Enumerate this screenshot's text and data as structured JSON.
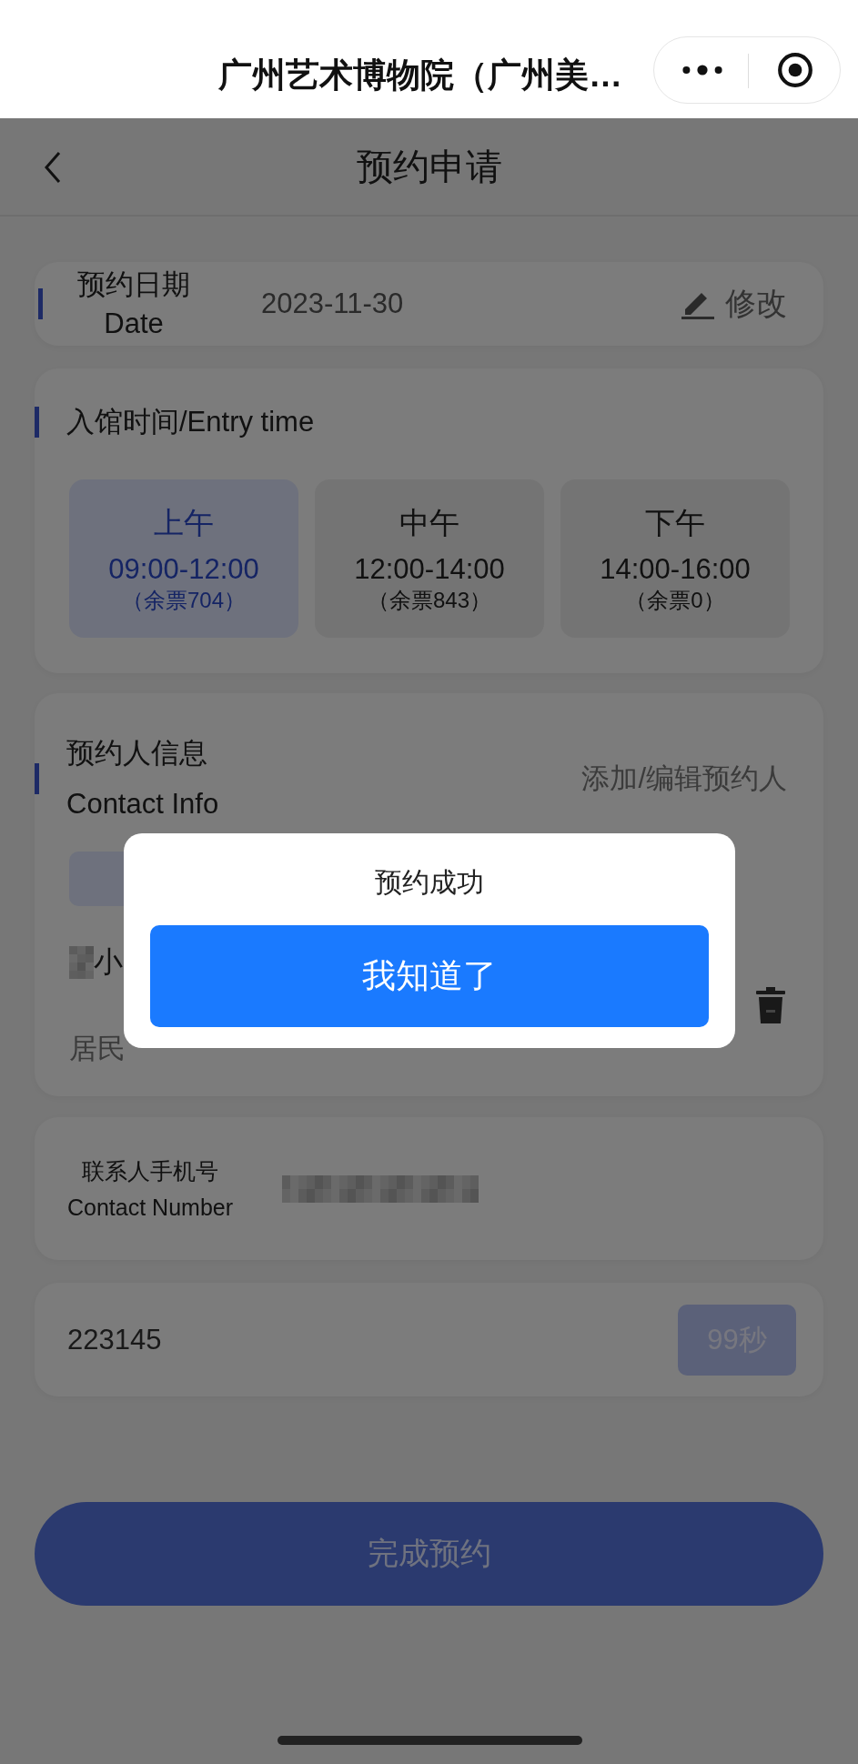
{
  "miniapp_bar": {
    "title": "广州艺术博物院（广州美…"
  },
  "nav": {
    "title": "预约申请"
  },
  "date": {
    "label_cn": "预约日期",
    "label_en": "Date",
    "value": "2023-11-30",
    "edit": "修改"
  },
  "entry_time": {
    "title": "入馆时间/Entry time",
    "slots": [
      {
        "period": "上午",
        "time": "09:00-12:00",
        "remaining": "（余票704）",
        "selected": true
      },
      {
        "period": "中午",
        "time": "12:00-14:00",
        "remaining": "（余票843）",
        "selected": false
      },
      {
        "period": "下午",
        "time": "14:00-16:00",
        "remaining": "（余票0）",
        "selected": false
      }
    ]
  },
  "contact": {
    "title_cn": "预约人信息",
    "title_en": "Contact Info",
    "action": "添加/编辑预约人",
    "person": {
      "name_visible": "小",
      "id_type": "居民"
    }
  },
  "phone": {
    "label_cn": "联系人手机号",
    "label_en": "Contact Number"
  },
  "code": {
    "value": "223145",
    "countdown": "99秒"
  },
  "submit": "完成预约",
  "dialog": {
    "title": "预约成功",
    "button": "我知道了"
  }
}
